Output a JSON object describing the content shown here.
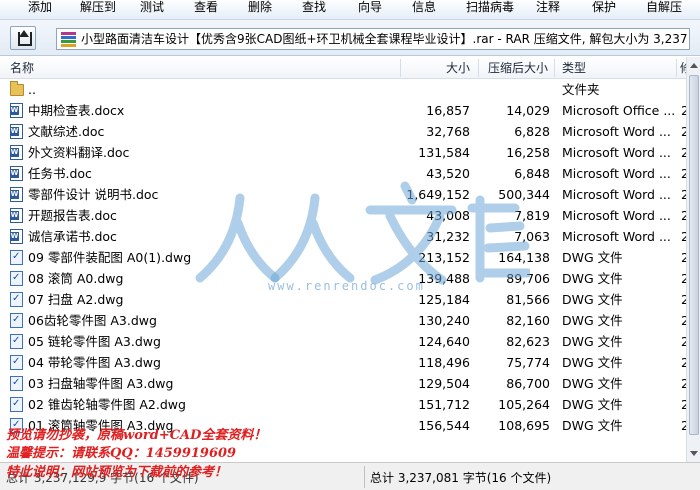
{
  "toolbar": {
    "items": [
      {
        "label": "添加"
      },
      {
        "label": "解压到"
      },
      {
        "label": "测试"
      },
      {
        "label": "查看"
      },
      {
        "label": "删除"
      },
      {
        "label": "查找"
      },
      {
        "label": "向导"
      },
      {
        "label": "信息"
      },
      {
        "label": "扫描病毒"
      },
      {
        "label": "注释"
      },
      {
        "label": "保护"
      },
      {
        "label": "自解压"
      }
    ]
  },
  "address": {
    "text": "小型路面清洁车设计【优秀含9张CAD图纸+环卫机械全套课程毕业设计】.rar - RAR 压缩文件, 解包大小为 3,237,081 字节"
  },
  "columns": {
    "name": "名称",
    "size": "大小",
    "packed": "压缩后大小",
    "type": "类型",
    "modified": "修"
  },
  "files": [
    {
      "icon": "folder",
      "name": "..",
      "size": "",
      "packed": "",
      "type": "文件夹",
      "mod": ""
    },
    {
      "icon": "word",
      "name": "中期检查表.docx",
      "size": "16,857",
      "packed": "14,029",
      "type": "Microsoft Office ...",
      "mod": "2"
    },
    {
      "icon": "word",
      "name": "文献综述.doc",
      "size": "32,768",
      "packed": "6,828",
      "type": "Microsoft Word ...",
      "mod": "2"
    },
    {
      "icon": "word",
      "name": "外文资料翻译.doc",
      "size": "131,584",
      "packed": "16,258",
      "type": "Microsoft Word ...",
      "mod": "2"
    },
    {
      "icon": "word",
      "name": "任务书.doc",
      "size": "43,520",
      "packed": "6,848",
      "type": "Microsoft Word ...",
      "mod": "2"
    },
    {
      "icon": "word",
      "name": "零部件设计 说明书.doc",
      "size": "1,649,152",
      "packed": "500,344",
      "type": "Microsoft Word ...",
      "mod": "2"
    },
    {
      "icon": "word",
      "name": "开题报告表.doc",
      "size": "43,008",
      "packed": "7,819",
      "type": "Microsoft Word ...",
      "mod": "2"
    },
    {
      "icon": "word",
      "name": "诚信承诺书.doc",
      "size": "31,232",
      "packed": "7,063",
      "type": "Microsoft Word ...",
      "mod": "2"
    },
    {
      "icon": "dwg",
      "name": "09 零部件装配图 A0(1).dwg",
      "size": "213,152",
      "packed": "164,138",
      "type": "DWG 文件",
      "mod": "2"
    },
    {
      "icon": "dwg",
      "name": "08 滚筒 A0.dwg",
      "size": "139,488",
      "packed": "89,706",
      "type": "DWG 文件",
      "mod": "2"
    },
    {
      "icon": "dwg",
      "name": "07 扫盘 A2.dwg",
      "size": "125,184",
      "packed": "81,566",
      "type": "DWG 文件",
      "mod": "2"
    },
    {
      "icon": "dwg",
      "name": "06齿轮零件图 A3.dwg",
      "size": "130,240",
      "packed": "82,160",
      "type": "DWG 文件",
      "mod": "2"
    },
    {
      "icon": "dwg",
      "name": "05 链轮零件图 A3.dwg",
      "size": "124,640",
      "packed": "82,623",
      "type": "DWG 文件",
      "mod": "2"
    },
    {
      "icon": "dwg",
      "name": "04 带轮零件图 A3.dwg",
      "size": "118,496",
      "packed": "75,774",
      "type": "DWG 文件",
      "mod": "2"
    },
    {
      "icon": "dwg",
      "name": "03 扫盘轴零件图 A3.dwg",
      "size": "129,504",
      "packed": "86,700",
      "type": "DWG 文件",
      "mod": "2"
    },
    {
      "icon": "dwg",
      "name": "02 锥齿轮轴零件图 A2.dwg",
      "size": "151,712",
      "packed": "105,264",
      "type": "DWG 文件",
      "mod": "2"
    },
    {
      "icon": "dwg",
      "name": "01 滚筒轴零件图 A3.dwg",
      "size": "156,544",
      "packed": "108,695",
      "type": "DWG 文件",
      "mod": "2"
    }
  ],
  "status": {
    "left": "总计 3,237,129,9 字节(16 个文件)",
    "right": "总计 3,237,081 字节(16 个文件)"
  },
  "watermark": {
    "chars": "人人文库",
    "url": "www.renrendoc.com"
  },
  "promo": {
    "line1": "预览请勿抄袭，原稿word+CAD全套资料！",
    "line2": "温馨提示：请联系QQ：1459919609",
    "line3": "特此说明：网站预览为下载前的参考！"
  }
}
